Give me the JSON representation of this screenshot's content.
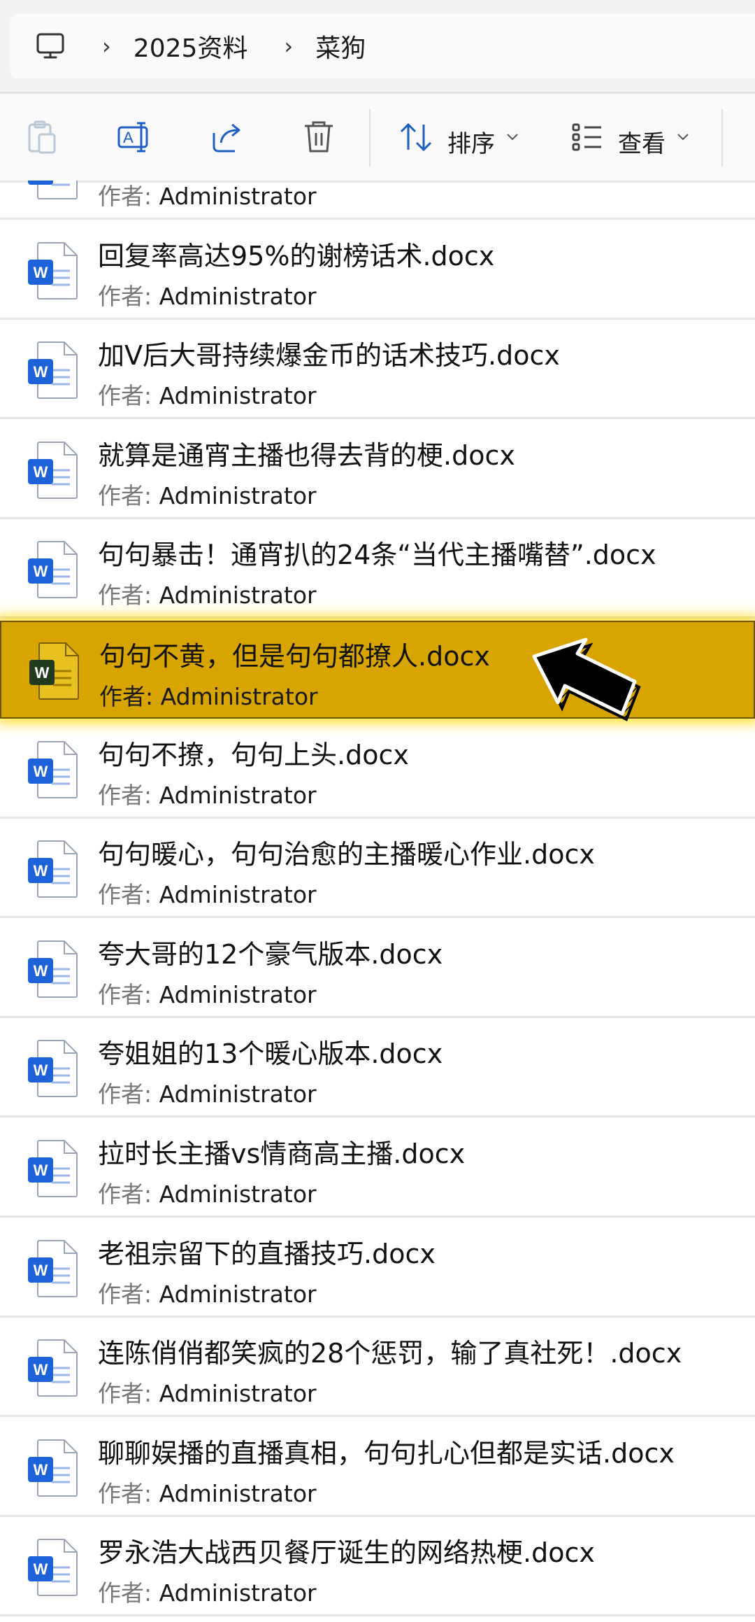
{
  "breadcrumb": {
    "items": [
      "2025资料",
      "菜狗"
    ]
  },
  "toolbar": {
    "sort_label": "排序",
    "view_label": "查看"
  },
  "author_key": "作者:",
  "files": [
    {
      "name": "",
      "author": "Administrator"
    },
    {
      "name": "回复率高达95%的谢榜话术.docx",
      "author": "Administrator"
    },
    {
      "name": "加V后大哥持续爆金币的话术技巧.docx",
      "author": "Administrator"
    },
    {
      "name": "就算是通宵主播也得去背的梗.docx",
      "author": "Administrator"
    },
    {
      "name": "句句暴击！通宵扒的24条“当代主播嘴替”.docx",
      "author": "Administrator"
    },
    {
      "name": "句句不黄，但是句句都撩人.docx",
      "author": "Administrator",
      "selected": true
    },
    {
      "name": "句句不撩，句句上头.docx",
      "author": "Administrator"
    },
    {
      "name": "句句暖心，句句治愈的主播暖心作业.docx",
      "author": "Administrator"
    },
    {
      "name": "夸大哥的12个豪气版本.docx",
      "author": "Administrator"
    },
    {
      "name": "夸姐姐的13个暖心版本.docx",
      "author": "Administrator"
    },
    {
      "name": "拉时长主播vs情商高主播.docx",
      "author": "Administrator"
    },
    {
      "name": "老祖宗留下的直播技巧.docx",
      "author": "Administrator"
    },
    {
      "name": "连陈俏俏都笑疯的28个惩罚，输了真社死！.docx",
      "author": "Administrator"
    },
    {
      "name": "聊聊娱播的直播真相，句句扎心但都是实话.docx",
      "author": "Administrator"
    },
    {
      "name": "罗永浩大战西贝餐厅诞生的网络热梗.docx",
      "author": "Administrator"
    }
  ],
  "colors": {
    "selection": "#d8a500",
    "word_blue": "#1e62d9"
  }
}
